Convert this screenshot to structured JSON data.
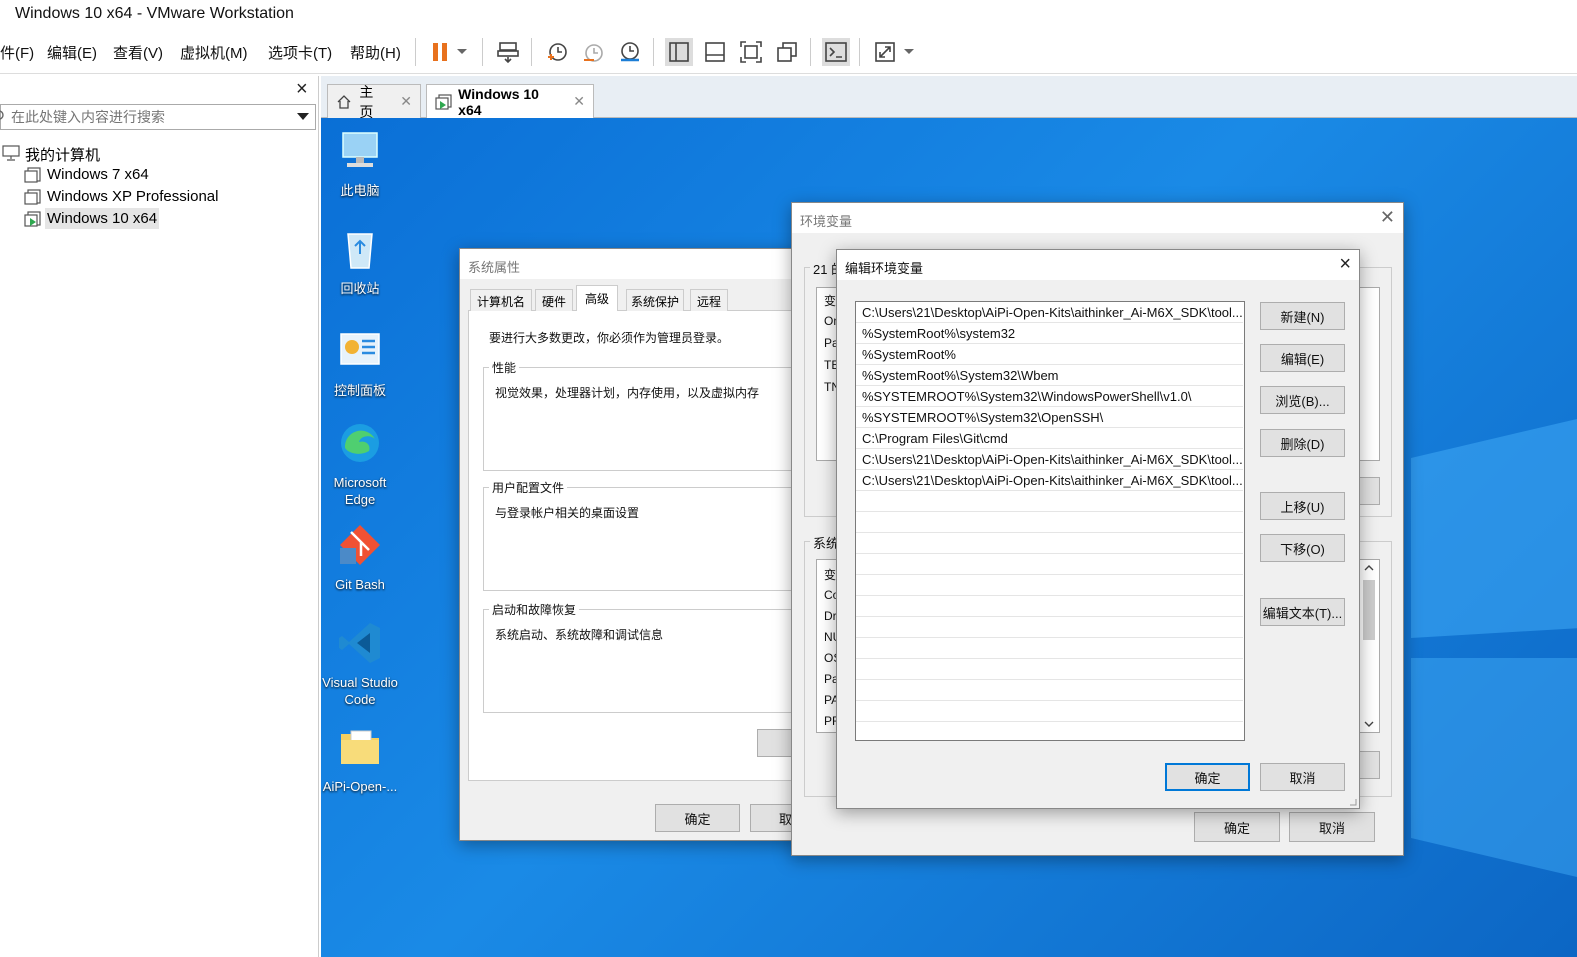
{
  "window": {
    "title": "Windows 10 x64 - VMware Workstation"
  },
  "menu": [
    "件(F)",
    "编辑(E)",
    "查看(V)",
    "虚拟机(M)",
    "选项卡(T)",
    "帮助(H)"
  ],
  "library": {
    "close": "×",
    "search_placeholder": "在此处键入内容进行搜索",
    "root": "我的计算机",
    "vms": [
      "Windows 7 x64",
      "Windows XP Professional",
      "Windows 10 x64"
    ]
  },
  "tabs": [
    {
      "label": "主页"
    },
    {
      "label": "Windows 10 x64"
    }
  ],
  "desktop_icons": [
    {
      "label": "此电脑",
      "icon": "computer-icon"
    },
    {
      "label": "回收站",
      "icon": "recycle-bin-icon"
    },
    {
      "label": "控制面板",
      "icon": "control-panel-icon"
    },
    {
      "label": "Microsoft Edge",
      "icon": "edge-icon"
    },
    {
      "label": "Git Bash",
      "icon": "git-icon"
    },
    {
      "label": "Visual Studio Code",
      "icon": "vscode-icon"
    },
    {
      "label": "AiPi-Open-...",
      "icon": "folder-icon"
    }
  ],
  "sysprops": {
    "title": "系统属性",
    "tabs": [
      "计算机名",
      "硬件",
      "高级",
      "系统保护",
      "远程"
    ],
    "admin_note": "要进行大多数更改，你必须作为管理员登录。",
    "perf_label": "性能",
    "perf_text": "视觉效果，处理器计划，内存使用，以及虚拟内存",
    "profile_label": "用户配置文件",
    "profile_text": "与登录帐户相关的桌面设置",
    "startup_label": "启动和故障恢复",
    "startup_text": "系统启动、系统故障和调试信息",
    "ok": "确定",
    "cancel": "取"
  },
  "envvars": {
    "title": "环境变量",
    "user_group": "21 的",
    "sys_group": "系统",
    "user_rows": [
      "变",
      "On",
      "Pa",
      "TE",
      "TN"
    ],
    "sys_rows": [
      "变",
      "Co",
      "Dr",
      "NU",
      "OS",
      "Pa",
      "PA",
      "PR"
    ],
    "ok": "确定",
    "cancel": "取消"
  },
  "editenv": {
    "title": "编辑环境变量",
    "close": "×",
    "entries": [
      "C:\\Users\\21\\Desktop\\AiPi-Open-Kits\\aithinker_Ai-M6X_SDK\\tool...",
      "%SystemRoot%\\system32",
      "%SystemRoot%",
      "%SystemRoot%\\System32\\Wbem",
      "%SYSTEMROOT%\\System32\\WindowsPowerShell\\v1.0\\",
      "%SYSTEMROOT%\\System32\\OpenSSH\\",
      "C:\\Program Files\\Git\\cmd",
      "C:\\Users\\21\\Desktop\\AiPi-Open-Kits\\aithinker_Ai-M6X_SDK\\tool...",
      "C:\\Users\\21\\Desktop\\AiPi-Open-Kits\\aithinker_Ai-M6X_SDK\\tool..."
    ],
    "buttons": {
      "new": "新建(N)",
      "edit": "编辑(E)",
      "browse": "浏览(B)...",
      "delete": "删除(D)",
      "up": "上移(U)",
      "down": "下移(O)",
      "edit_text": "编辑文本(T)..."
    },
    "ok": "确定",
    "cancel": "取消"
  }
}
